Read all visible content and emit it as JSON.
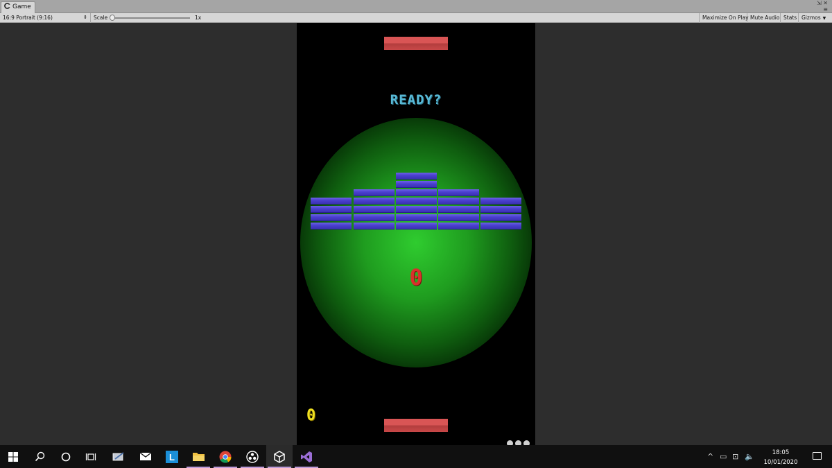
{
  "window": {
    "tab_label": "Game",
    "controls": [
      "⇲",
      "≡"
    ],
    "close": "✕"
  },
  "toolbar": {
    "aspect": "16:9 Portrait (9:16)",
    "scale_label": "Scale",
    "scale_value": "1x",
    "maximize": "Maximize On Play",
    "mute": "Mute Audio",
    "stats": "Stats",
    "gizmos": "Gizmos"
  },
  "game": {
    "ready_text": "READY?",
    "center_score": "0",
    "player_score": "0",
    "lives_remaining": 3,
    "brick_layout": [
      1,
      2,
      3,
      2,
      1
    ],
    "colors": {
      "paddle": "#d95555",
      "brick": "#4a3fcf",
      "glow": "#2fcc2f",
      "ready": "#58b9d6",
      "center_score": "#d9302b",
      "player_score": "#f0e020"
    }
  },
  "taskbar": {
    "icons": [
      "windows-start-icon",
      "search-icon",
      "cortana-icon",
      "task-view-icon",
      "stylus-icon",
      "mail-icon",
      "l-app-icon",
      "file-explorer-icon",
      "chrome-icon",
      "obs-icon",
      "unity-icon",
      "visual-studio-icon"
    ],
    "clock_time": "18:05",
    "clock_date": "10/01/2020"
  }
}
